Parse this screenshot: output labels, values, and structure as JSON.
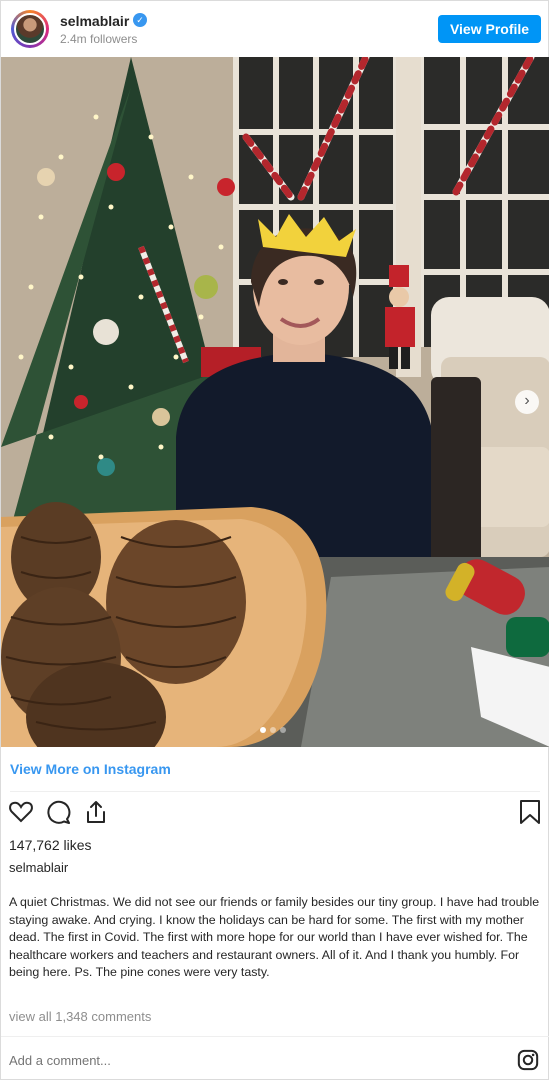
{
  "header": {
    "username": "selmablair",
    "verified_mark": "✓",
    "followers": "2.4m followers",
    "view_profile_label": "View Profile"
  },
  "post": {
    "image_icon": "photo-christmas-tree",
    "carousel": {
      "count": 3,
      "active_index": 0,
      "next_icon": "chevron-right-icon",
      "next_glyph": "›"
    },
    "view_more_label": "View More on Instagram",
    "actions": [
      "heart-icon",
      "comment-icon",
      "share-icon",
      "bookmark-icon"
    ],
    "likes": "147,762 likes",
    "caption_user": "selmablair",
    "caption": "A quiet Christmas. We did not see our friends or family besides our tiny group. I have had trouble staying awake. And crying. I know the holidays can be hard for some. The first with my mother dead. The first in Covid. The first with more hope for our world than I have ever wished for. The healthcare workers and teachers and restaurant owners. All of it. And I thank you humbly. For being here. Ps. The pine cones were very tasty.",
    "view_comments": "view all 1,348 comments",
    "comment_placeholder": "Add a comment...",
    "footer_icon": "instagram-icon"
  },
  "colors": {
    "accent": "#0095f6",
    "link": "#3897f0",
    "text": "#262626",
    "muted": "#8e8e8e"
  }
}
